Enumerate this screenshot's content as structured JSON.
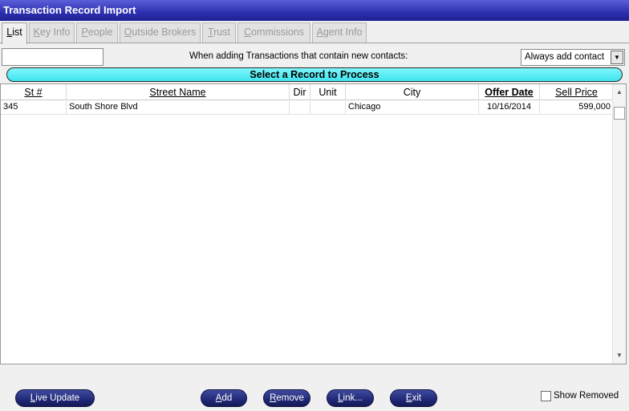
{
  "window": {
    "title": "Transaction Record Import"
  },
  "tabs": [
    {
      "pre": "",
      "u": "L",
      "post": "ist",
      "active": true
    },
    {
      "pre": "",
      "u": "K",
      "post": "ey Info",
      "active": false
    },
    {
      "pre": "",
      "u": "P",
      "post": "eople",
      "active": false
    },
    {
      "pre": "",
      "u": "O",
      "post": "utside Brokers",
      "active": false
    },
    {
      "pre": "",
      "u": "T",
      "post": "rust",
      "active": false
    },
    {
      "pre": "",
      "u": "C",
      "post": "ommissions",
      "active": false
    },
    {
      "pre": "",
      "u": "A",
      "post": "gent Info",
      "active": false
    }
  ],
  "filter": {
    "value": ""
  },
  "options": {
    "hint": "When adding Transactions that contain new contacts:",
    "selected": "Always add contact"
  },
  "banner": "Select a Record to Process",
  "table": {
    "columns": [
      "St #",
      "Street Name",
      "Dir",
      "Unit",
      "City",
      "Offer Date",
      "Sell Price"
    ],
    "rows": [
      {
        "st": "345",
        "street": "South Shore Blvd",
        "dir": "",
        "unit": "",
        "city": "Chicago",
        "offer_date": "10/16/2014",
        "sell_price": "599,000"
      }
    ]
  },
  "buttons": {
    "live_update": {
      "u": "L",
      "rest": "ive Update"
    },
    "add": {
      "u": "A",
      "rest": "dd"
    },
    "remove": {
      "u": "R",
      "rest": "emove"
    },
    "link": {
      "u": "L",
      "rest": "ink..."
    },
    "exit": {
      "u": "E",
      "rest": "xit"
    }
  },
  "show_removed": {
    "label": "Show Removed",
    "checked": false
  },
  "colors": {
    "title_bar": "#2d30b0",
    "banner": "#3fe4ef",
    "button": "#1c2470"
  }
}
